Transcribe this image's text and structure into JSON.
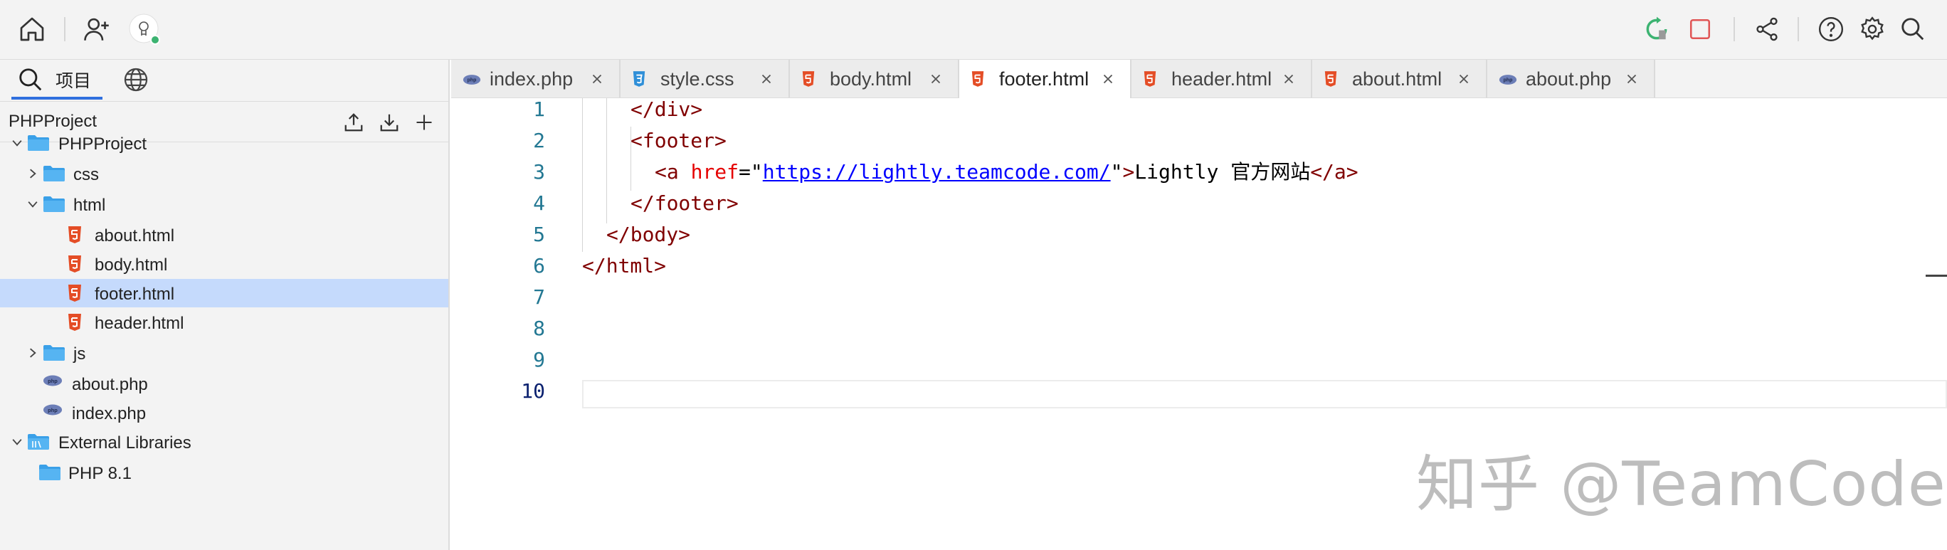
{
  "toolbar": {
    "left_icons": [
      "home-icon",
      "add-user-icon",
      "avatar-lightbulb-icon"
    ],
    "right_icons": [
      "run-refresh-icon",
      "stop-icon",
      "share-icon",
      "help-icon",
      "settings-icon",
      "search-icon"
    ],
    "colors": {
      "run": "#3cb371",
      "stop": "#e05555",
      "online_dot": "#3cb371"
    }
  },
  "sidebar": {
    "tabs": [
      {
        "icon": "search-icon",
        "label": "项目"
      },
      {
        "icon": "globe-icon",
        "label": ""
      }
    ],
    "project_name": "PHPProject",
    "header_actions": [
      "upload-icon",
      "download-icon",
      "plus-icon"
    ],
    "tree": [
      {
        "label": "PHPProject",
        "type": "folder",
        "expanded": true,
        "depth": 0
      },
      {
        "label": "css",
        "type": "folder",
        "expanded": false,
        "depth": 1
      },
      {
        "label": "html",
        "type": "folder",
        "expanded": true,
        "depth": 1
      },
      {
        "label": "about.html",
        "type": "html",
        "depth": 2
      },
      {
        "label": "body.html",
        "type": "html",
        "depth": 2
      },
      {
        "label": "footer.html",
        "type": "html",
        "depth": 2,
        "selected": true
      },
      {
        "label": "header.html",
        "type": "html",
        "depth": 2
      },
      {
        "label": "js",
        "type": "folder",
        "expanded": false,
        "depth": 1
      },
      {
        "label": "about.php",
        "type": "php",
        "depth": 1
      },
      {
        "label": "index.php",
        "type": "php",
        "depth": 1
      },
      {
        "label": "External Libraries",
        "type": "library",
        "expanded": true,
        "depth": 0
      },
      {
        "label": "PHP 8.1",
        "type": "folder",
        "depth": 1
      }
    ]
  },
  "tabs": [
    {
      "label": "index.php",
      "type": "php"
    },
    {
      "label": "style.css",
      "type": "css"
    },
    {
      "label": "body.html",
      "type": "html"
    },
    {
      "label": "footer.html",
      "type": "html",
      "active": true
    },
    {
      "label": "header.html",
      "type": "html"
    },
    {
      "label": "about.html",
      "type": "html"
    },
    {
      "label": "about.php",
      "type": "php"
    }
  ],
  "editor": {
    "line_numbers": [
      "1",
      "2",
      "3",
      "4",
      "5",
      "6",
      "7",
      "8",
      "9",
      "10"
    ],
    "current_line": "10",
    "lines": [
      {
        "segments": [
          [
            "tag",
            "</div>"
          ]
        ]
      },
      {
        "segments": [
          [
            "tag",
            "<footer>"
          ]
        ]
      },
      {
        "segments": [
          [
            "tag",
            "<a "
          ],
          [
            "attr",
            "href"
          ],
          [
            "plain",
            "=\""
          ],
          [
            "str",
            "https://lightly.teamcode.com/"
          ],
          [
            "plain",
            "\""
          ],
          [
            "tag",
            ">"
          ],
          [
            "plain",
            "Lightly 官方网站"
          ],
          [
            "tag",
            "</a>"
          ]
        ]
      },
      {
        "segments": [
          [
            "tag",
            "</footer>"
          ]
        ]
      },
      {
        "segments": [
          [
            "tag",
            "</body>"
          ]
        ]
      },
      {
        "segments": [
          [
            "tag",
            "</html>"
          ]
        ]
      },
      {
        "segments": []
      },
      {
        "segments": []
      },
      {
        "segments": []
      },
      {
        "segments": []
      }
    ],
    "syntax_colors": {
      "tag": "#800000",
      "attr": "#e50000",
      "str": "#0000ff",
      "line_number": "#237893"
    }
  },
  "watermark": "知乎 @TeamCode"
}
